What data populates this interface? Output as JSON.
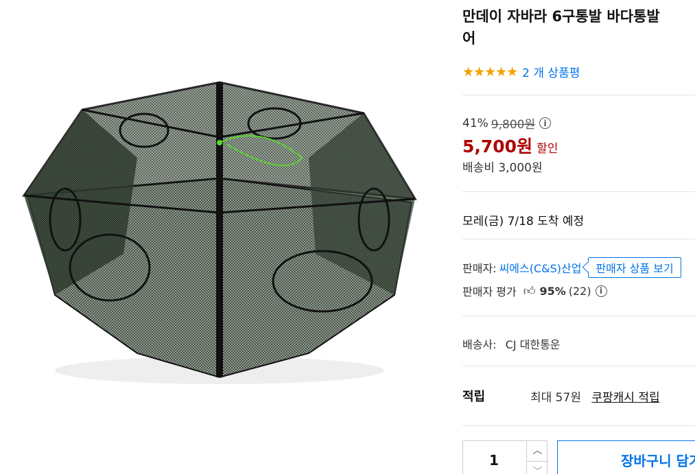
{
  "product": {
    "title_line1": "만데이 자바라 6구통발 바다통발",
    "title_line2": "어",
    "stars": "★★★★★",
    "rating_value": 5,
    "review_link": "2 개 상품평"
  },
  "price": {
    "discount_rate": "41%",
    "original_price": "9,800원",
    "sale_price": "5,700원",
    "sale_tag": "할인",
    "shipping": "배송비 3,000원"
  },
  "delivery": {
    "text": "모레(금) 7/18 도착 예정"
  },
  "seller": {
    "label": "판매자:",
    "name": "씨에스(C&S)산업",
    "button": "판매자 상품 보기",
    "rating_label": "판매자 평가",
    "rating_percent": "95%",
    "rating_count": "(22)"
  },
  "carrier": {
    "label": "배송사:",
    "name": "CJ 대한통운"
  },
  "reward": {
    "label": "적립",
    "value": "최대 57원",
    "link": "쿠팡캐시 적립"
  },
  "purchase": {
    "quantity": "1",
    "cart_button": "장바구니 담기"
  },
  "icons": {
    "info": "info-icon",
    "thumb": "thumbs-up-icon",
    "up": "chevron-up-icon",
    "down": "chevron-down-icon"
  },
  "colors": {
    "accent_blue": "#0073e9",
    "sale_red": "#ae0000",
    "star": "#f5a000"
  }
}
